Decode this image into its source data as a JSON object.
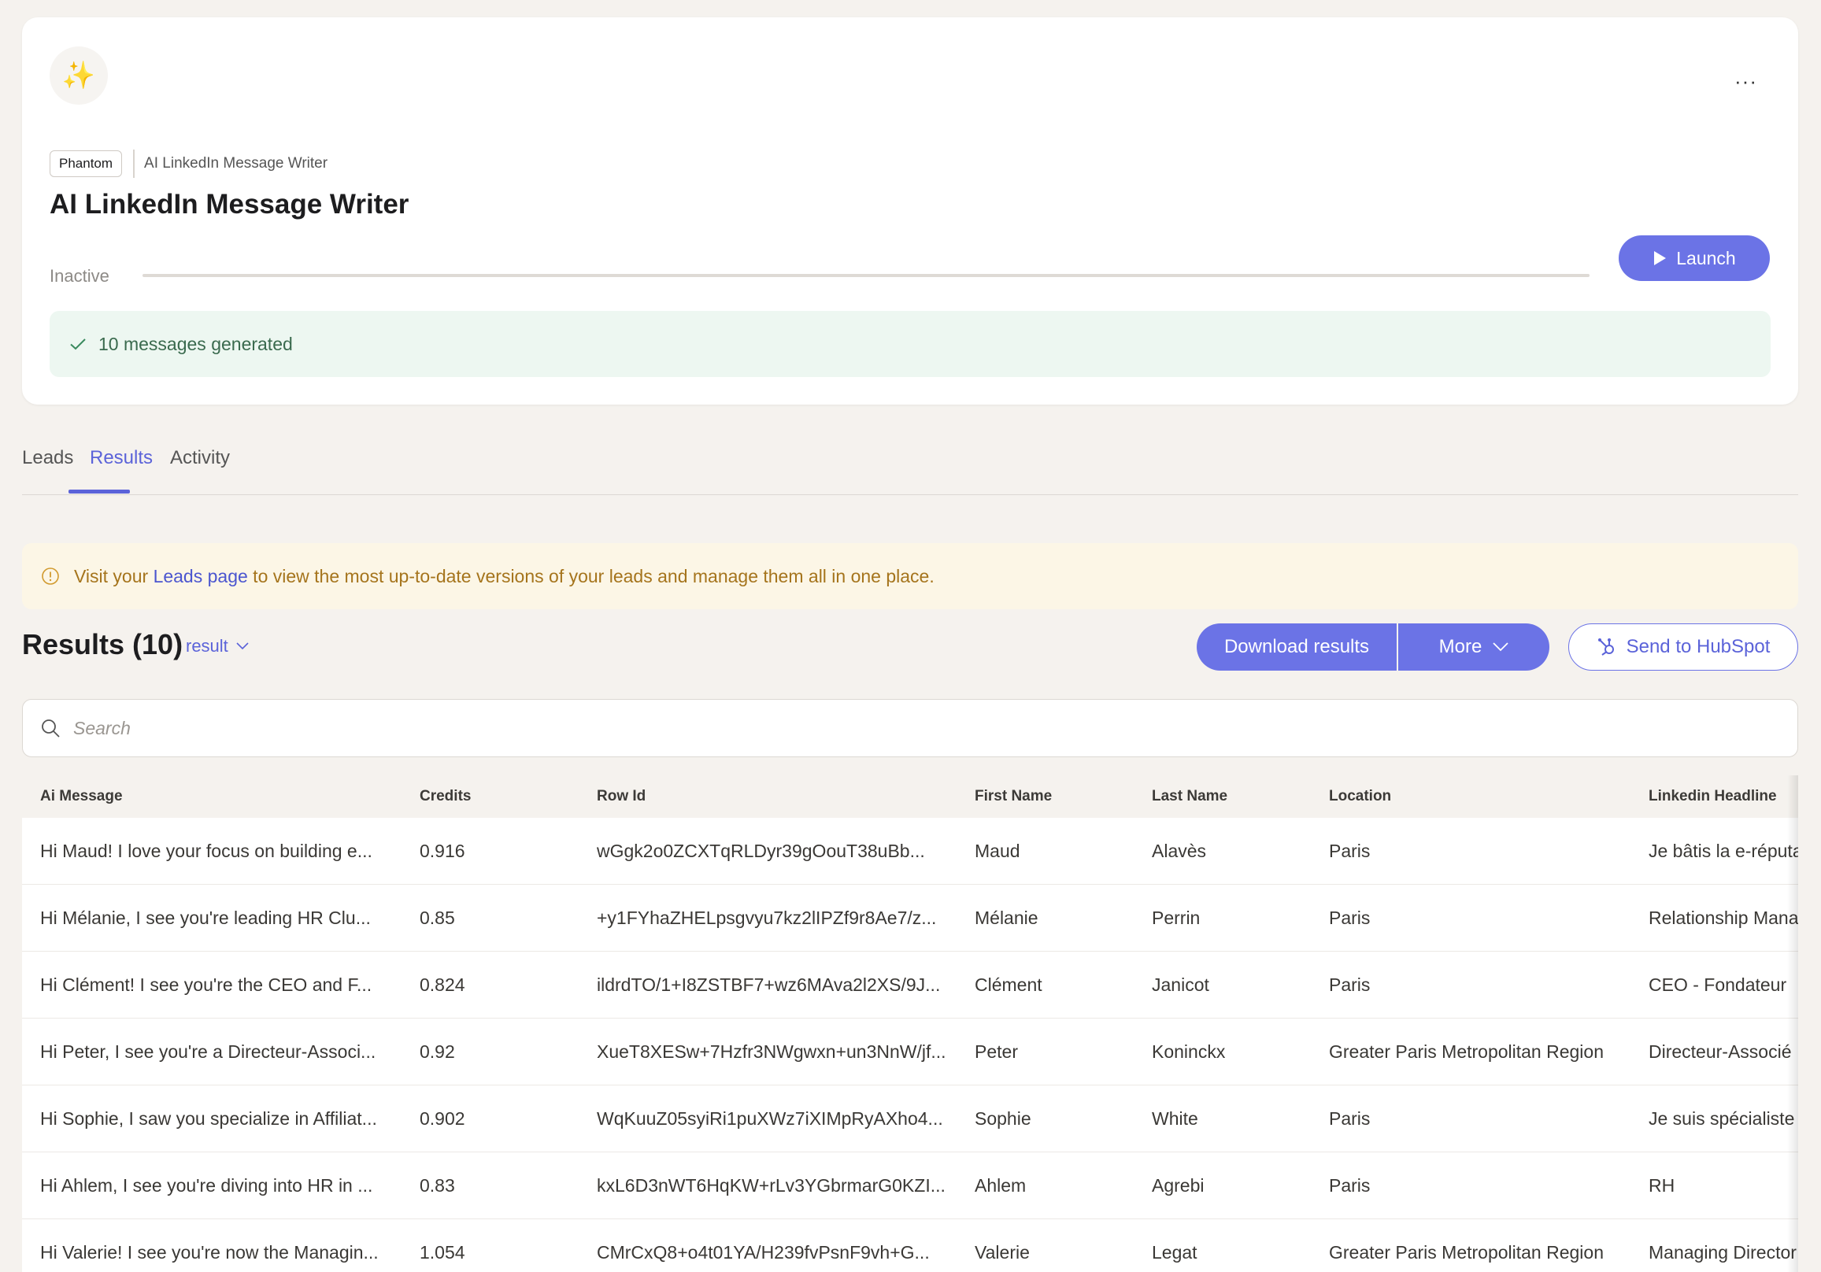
{
  "phantom": {
    "icon": "sparkles-icon",
    "badge": "Phantom",
    "breadcrumb": "AI LinkedIn Message Writer",
    "title": "AI LinkedIn Message Writer",
    "status": "Inactive",
    "launch_label": "Launch",
    "success_message": "10 messages generated"
  },
  "tabs": [
    {
      "label": "Leads"
    },
    {
      "label": "Results"
    },
    {
      "label": "Activity"
    }
  ],
  "notice": {
    "before": "Visit your ",
    "link": "Leads page",
    "after": " to view the most up-to-date versions of your leads and manage them all in one place."
  },
  "results": {
    "title": "Results (10)",
    "selector": "result",
    "download_label": "Download results",
    "more_label": "More",
    "hubspot_label": "Send to HubSpot"
  },
  "search": {
    "placeholder": "Search"
  },
  "table": {
    "columns": [
      "Ai Message",
      "Credits",
      "Row Id",
      "First Name",
      "Last Name",
      "Location",
      "Linkedin Headline"
    ],
    "rows": [
      [
        "Hi Maud! I love your focus on building e...",
        "0.916",
        "wGgk2o0ZCXTqRLDyr39gOouT38uBb...",
        "Maud",
        "Alavès",
        "Paris",
        "Je bâtis la e-réputation"
      ],
      [
        "Hi Mélanie, I see you're leading HR Clu...",
        "0.85",
        "+y1FYhaZHELpsgvyu7kz2lIPZf9r8Ae7/z...",
        "Mélanie",
        "Perrin",
        "Paris",
        "Relationship Manager"
      ],
      [
        "Hi Clément! I see you're the CEO and F...",
        "0.824",
        "ildrdTO/1+I8ZSTBF7+wz6MAva2l2XS/9J...",
        "Clément",
        "Janicot",
        "Paris",
        "CEO - Fondateur"
      ],
      [
        "Hi Peter, I see you're a Directeur-Associ...",
        "0.92",
        "XueT8XESw+7Hzfr3NWgwxn+un3NnW/jf...",
        "Peter",
        "Koninckx",
        "Greater Paris Metropolitan Region",
        "Directeur-Associé"
      ],
      [
        "Hi Sophie, I saw you specialize in Affiliat...",
        "0.902",
        "WqKuuZ05syiRi1puXWz7iXIMpRyAXho4...",
        "Sophie",
        "White",
        "Paris",
        "Je suis spécialiste"
      ],
      [
        "Hi Ahlem, I see you're diving into HR in ...",
        "0.83",
        "kxL6D3nWT6HqKW+rLv3YGbrmarG0KZI...",
        "Ahlem",
        "Agrebi",
        "Paris",
        "RH"
      ],
      [
        "Hi Valerie! I see you're now the Managin...",
        "1.054",
        "CMrCxQ8+o4t01YA/H239fvPsnF9vh+G...",
        "Valerie",
        "Legat",
        "Greater Paris Metropolitan Region",
        "Managing Director"
      ]
    ]
  },
  "colors": {
    "accent": "#6b73e6",
    "success_bg": "#edf7f1",
    "warning_bg": "#fcf6e6",
    "page_bg": "#f5f2ee"
  }
}
